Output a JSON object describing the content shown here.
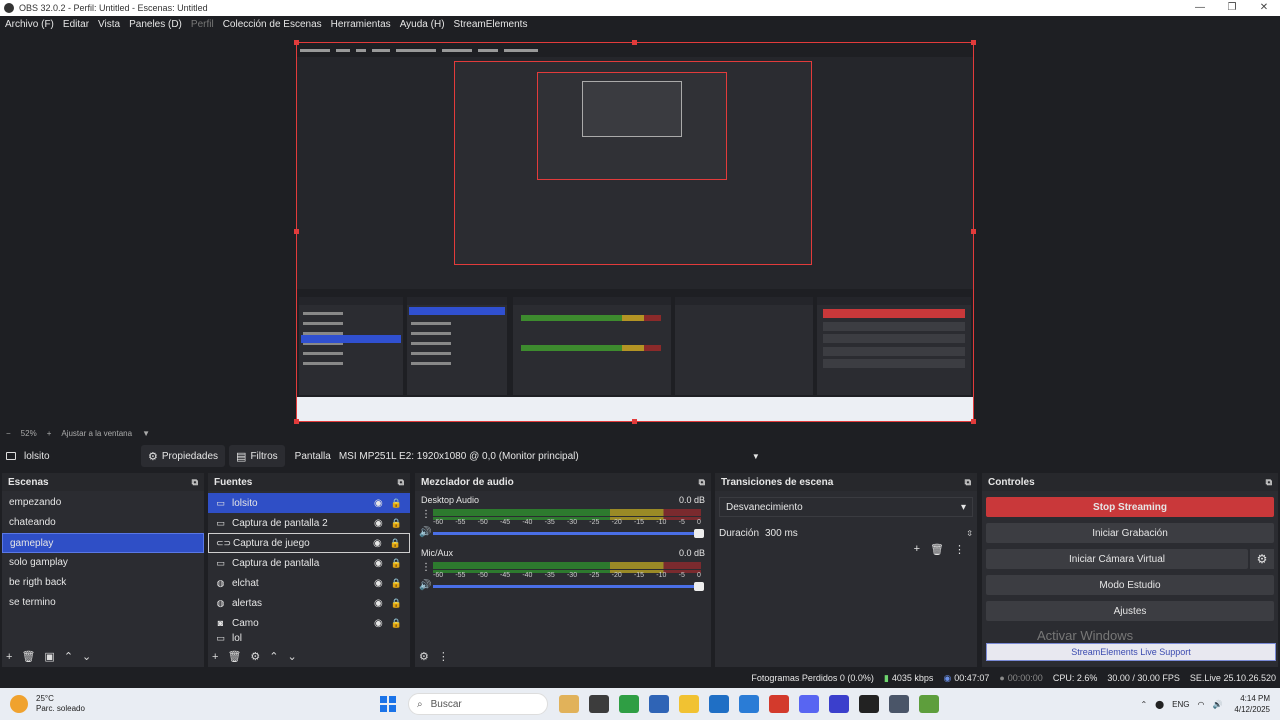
{
  "window": {
    "title": "OBS 32.0.2 - Perfil: Untitled - Escenas: Untitled",
    "controls": [
      "—",
      "❐",
      "✕"
    ]
  },
  "menu": [
    {
      "label": "Archivo (F)",
      "enabled": true
    },
    {
      "label": "Editar",
      "enabled": true
    },
    {
      "label": "Vista",
      "enabled": true
    },
    {
      "label": "Paneles (D)",
      "enabled": true
    },
    {
      "label": "Perfil",
      "enabled": false
    },
    {
      "label": "Colección de Escenas",
      "enabled": true
    },
    {
      "label": "Herramientas",
      "enabled": true
    },
    {
      "label": "Ayuda (H)",
      "enabled": true
    },
    {
      "label": "StreamElements",
      "enabled": true
    }
  ],
  "zoom": {
    "minus": "−",
    "value": "52%",
    "plus": "+",
    "fit_label": "Ajustar a la ventana",
    "dropdown": "▼"
  },
  "source_toolbar": {
    "selected_source": "lolsito",
    "properties_label": "Propiedades",
    "filters_label": "Filtros",
    "pantalla_label": "Pantalla",
    "monitor_value": "MSI MP251L E2: 1920x1080 @ 0,0 (Monitor principal)"
  },
  "scenes": {
    "title": "Escenas",
    "items": [
      {
        "label": "empezando",
        "active": false
      },
      {
        "label": "chateando",
        "active": false
      },
      {
        "label": "gameplay",
        "active": true
      },
      {
        "label": "solo gamplay",
        "active": false
      },
      {
        "label": "be rigth back",
        "active": false
      },
      {
        "label": "se termino",
        "active": false
      }
    ],
    "footer": [
      "+",
      "🗑",
      "▣",
      "⌃",
      "⌄"
    ]
  },
  "sources": {
    "title": "Fuentes",
    "items": [
      {
        "label": "lolsito",
        "icon": "monitor-icon",
        "glyph": "▭",
        "active": true,
        "outlined": false
      },
      {
        "label": "Captura de pantalla 2",
        "icon": "monitor-icon",
        "glyph": "▭",
        "active": false,
        "outlined": false
      },
      {
        "label": "Captura de juego",
        "icon": "gamepad-icon",
        "glyph": "⊂⊃",
        "active": false,
        "outlined": true
      },
      {
        "label": "Captura de pantalla",
        "icon": "monitor-icon",
        "glyph": "▭",
        "active": false,
        "outlined": false
      },
      {
        "label": "elchat",
        "icon": "globe-icon",
        "glyph": "◍",
        "active": false,
        "outlined": false
      },
      {
        "label": "alertas",
        "icon": "globe-icon",
        "glyph": "◍",
        "active": false,
        "outlined": false
      },
      {
        "label": "Camo",
        "icon": "camera-icon",
        "glyph": "◙",
        "active": false,
        "outlined": false
      },
      {
        "label": "lol",
        "icon": "monitor-icon",
        "glyph": "▭",
        "active": false,
        "outlined": false
      }
    ],
    "footer": [
      "+",
      "🗑",
      "⚙",
      "⌃",
      "⌄"
    ]
  },
  "mixer": {
    "title": "Mezclador de audio",
    "ticks": [
      "-60",
      "-55",
      "-50",
      "-45",
      "-40",
      "-35",
      "-30",
      "-25",
      "-20",
      "-15",
      "-10",
      "-5",
      "0"
    ],
    "tracks": [
      {
        "name": "Desktop Audio",
        "level": "0.0 dB",
        "volume": 1.0
      },
      {
        "name": "Mic/Aux",
        "level": "0.0 dB",
        "volume": 1.0
      }
    ],
    "footer": [
      "⚙",
      "⋮"
    ]
  },
  "transitions": {
    "title": "Transiciones de escena",
    "selected": "Desvanecimiento",
    "duration_label": "Duración",
    "duration_value": "300 ms",
    "tools": [
      "+",
      "🗑",
      "⋮"
    ]
  },
  "controls": {
    "title": "Controles",
    "buttons": [
      {
        "label": "Stop Streaming",
        "style": "red"
      },
      {
        "label": "Iniciar Grabación",
        "style": "normal"
      },
      {
        "label": "Iniciar Cámara Virtual",
        "style": "normal"
      },
      {
        "label": "Modo Estudio",
        "style": "normal"
      },
      {
        "label": "Ajustes",
        "style": "normal"
      }
    ],
    "watermark": "Activar Windows",
    "support_label": "StreamElements Live Support"
  },
  "status": {
    "dropped_frames": "Fotogramas Perdidos 0 (0.0%)",
    "bitrate": "4035 kbps",
    "stream_time": "00:47:07",
    "rec_time": "00:00:00",
    "cpu": "CPU: 2.6%",
    "fps": "30.00 / 30.00 FPS",
    "version": "SE.Live 25.10.26.520"
  },
  "taskbar": {
    "temperature": "25°C",
    "weather": "Parc. soleado",
    "search_placeholder": "Buscar",
    "lang": "ENG",
    "time": "4:14 PM",
    "date": "4/12/2025",
    "app_colors": [
      "#e1b25a",
      "#3c3c3c",
      "#2f9e44",
      "#2f64b6",
      "#f1c232",
      "#1f6fc5",
      "#2a7cd6",
      "#d33a2c",
      "#5865f2",
      "#3b3fcc",
      "#222222",
      "#4a5568",
      "#5e9e3c"
    ]
  },
  "colors": {
    "accent": "#2f4fc6",
    "stop_streaming": "#c9383a",
    "meter_green": "#2d7a2e",
    "meter_yellow": "#9a8a26",
    "meter_red": "#7a2a2e",
    "canvas_border": "#e23b3b"
  }
}
